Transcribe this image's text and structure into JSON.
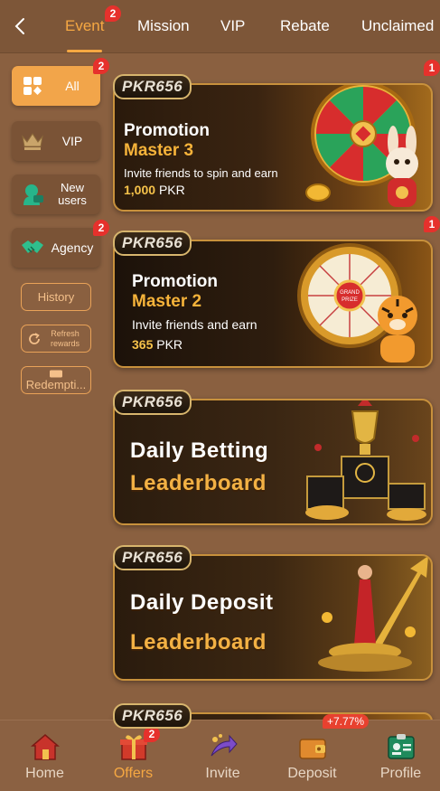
{
  "tabs": [
    {
      "label": "Event",
      "badge": "2",
      "active": true
    },
    {
      "label": "Mission"
    },
    {
      "label": "VIP"
    },
    {
      "label": "Rebate"
    },
    {
      "label": "Unclaimed"
    }
  ],
  "sidebar": {
    "items": [
      {
        "label": "All",
        "badge": "2",
        "active": true
      },
      {
        "label": "VIP"
      },
      {
        "label": "New users"
      },
      {
        "label": "Agency",
        "badge": "2"
      }
    ],
    "buttons": {
      "history": "History",
      "refresh": "Refresh rewards",
      "redemption": "Redempti..."
    }
  },
  "banners": [
    {
      "logo": "PKR656",
      "title_line1": "Promotion",
      "title_line2": "Master 3",
      "subtitle": "Invite friends to spin and earn",
      "amount": "1,000",
      "currency": "PKR",
      "badge": "1"
    },
    {
      "logo": "PKR656",
      "title_line1": "Promotion",
      "title_line2": "Master 2",
      "subtitle": "Invite friends and earn",
      "amount": "365",
      "currency": "PKR",
      "badge": "1"
    },
    {
      "logo": "PKR656",
      "title_line1": "Daily Betting",
      "title_line2": "Leaderboard"
    },
    {
      "logo": "PKR656",
      "title_line1": "Daily Deposit",
      "title_line2": "Leaderboard"
    },
    {
      "logo": "PKR656"
    }
  ],
  "bottom_nav": [
    {
      "label": "Home",
      "icon": "house-icon"
    },
    {
      "label": "Offers",
      "icon": "gift-icon",
      "badge": "2",
      "active": true
    },
    {
      "label": "Invite",
      "icon": "invite-arrow-icon"
    },
    {
      "label": "Deposit",
      "icon": "wallet-icon",
      "tag": "+7.77%"
    },
    {
      "label": "Profile",
      "icon": "id-card-icon"
    }
  ],
  "colors": {
    "accent": "#f6a842",
    "background": "#8a6040",
    "badge": "#e6312c"
  }
}
